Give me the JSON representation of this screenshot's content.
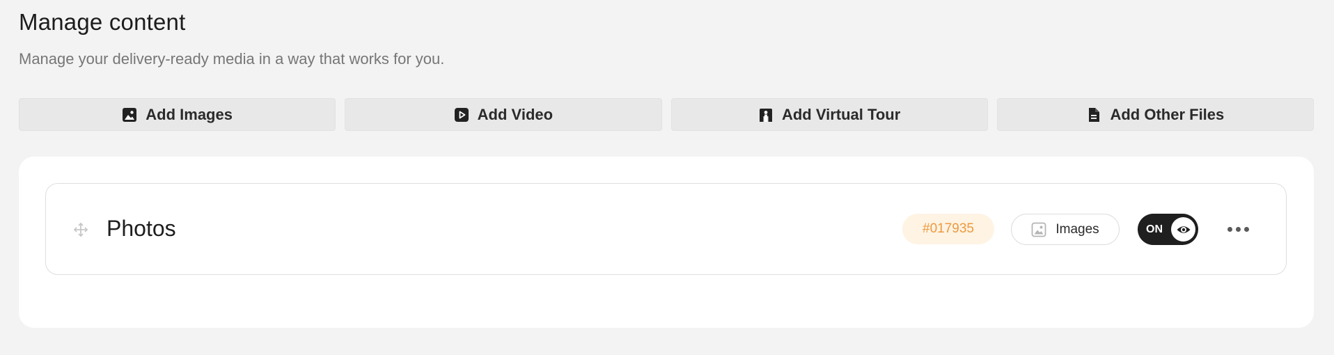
{
  "header": {
    "title": "Manage content",
    "subtitle": "Manage your delivery-ready media in a way that works for you."
  },
  "actions": [
    {
      "label": "Add Images",
      "icon": "image-icon"
    },
    {
      "label": "Add Video",
      "icon": "video-icon"
    },
    {
      "label": "Add Virtual Tour",
      "icon": "virtual-tour-icon"
    },
    {
      "label": "Add Other Files",
      "icon": "file-icon"
    }
  ],
  "content_rows": [
    {
      "title": "Photos",
      "tag": "#017935",
      "type_label": "Images",
      "visibility_label": "ON",
      "visible": true
    }
  ],
  "colors": {
    "page_background": "#f3f3f3",
    "tag_text": "#ec9a3e",
    "tag_background": "#fff3e3",
    "toggle_background": "#1f1f1f"
  }
}
